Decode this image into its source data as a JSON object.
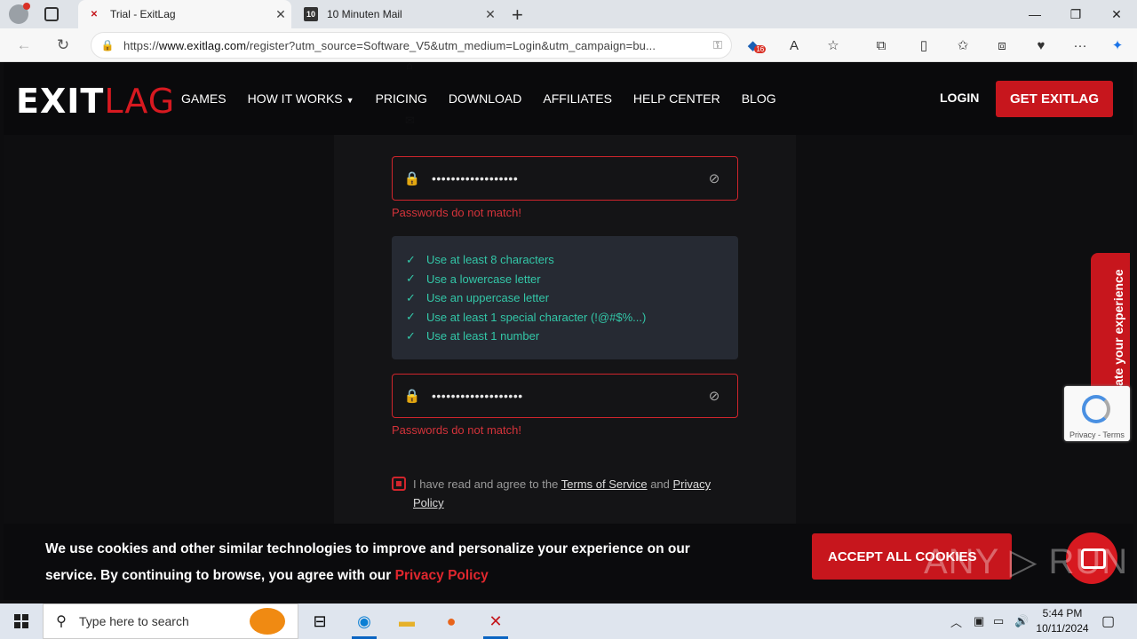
{
  "browser": {
    "tabs": [
      {
        "title": "Trial - ExitLag",
        "favicon": "exitlag-favicon",
        "active": true
      },
      {
        "title": "10 Minuten Mail",
        "favicon": "10-icon",
        "active": false
      }
    ],
    "ten_icon_text": "10",
    "url_prefix": "https://",
    "url_host": "www.exitlag.com",
    "url_path": "/register?utm_source=Software_V5&utm_medium=Login&utm_campaign=bu...",
    "extension_badge": "16"
  },
  "header": {
    "logo_exit": "EXIT",
    "logo_lag": "LAG",
    "nav": [
      "GAMES",
      "HOW IT WORKS",
      "PRICING",
      "DOWNLOAD",
      "AFFILIATES",
      "HELP CENTER",
      "BLOG"
    ],
    "login": "LOGIN",
    "cta": "GET EXITLAG"
  },
  "form": {
    "password_value": "••••••••••••••••••",
    "confirm_value": "•••••••••••••••••••",
    "error_text": "Passwords do not match!",
    "rules": [
      "Use at least 8 characters",
      "Use a lowercase letter",
      "Use an uppercase letter",
      "Use at least 1 special character (!@#$%...)",
      "Use at least 1 number"
    ],
    "agree_prefix": "I have read and agree to the",
    "terms": "Terms of Service",
    "and": "and",
    "privacy": "Privacy Policy"
  },
  "rate": {
    "label": "Rate your experience"
  },
  "recaptcha": {
    "footer": "Privacy - Terms"
  },
  "cookie": {
    "message": "We use cookies and other similar technologies to improve and personalize your experience on our service. By continuing to browse, you agree with our",
    "policy_link": "Privacy Policy",
    "accept": "ACCEPT ALL COOKIES"
  },
  "watermark": "ANY ▷ RUN",
  "taskbar": {
    "search_placeholder": "Type here to search",
    "time": "5:44 PM",
    "date": "10/11/2024"
  },
  "colors": {
    "accent": "#c7161d",
    "rule_green": "#33c7a8",
    "error": "#d4333a"
  }
}
